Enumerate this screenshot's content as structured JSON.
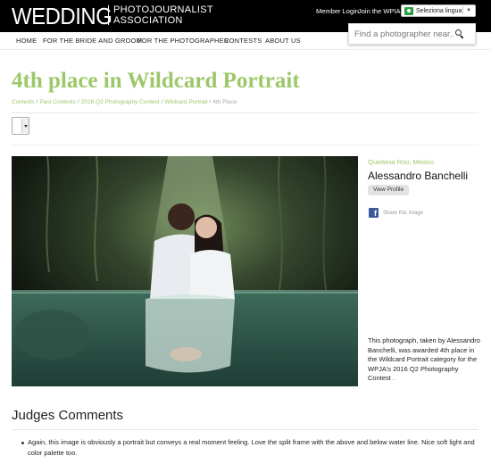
{
  "header": {
    "logo_main": "WEDDING",
    "logo_line1": "PHOTOJOURNALIST",
    "logo_line2": "ASSOCIATION",
    "member_login": "Member Login",
    "join": "Join the WPIA",
    "language_label": "Seleziona lingua",
    "search_placeholder": "Find a photographer near..."
  },
  "nav": {
    "items": [
      "HOME",
      "FOR THE BRIDE AND GROOM",
      "FOR THE PHOTOGRAPHER",
      "CONTESTS",
      "ABOUT US"
    ]
  },
  "page": {
    "title": "4th place in Wildcard Portrait",
    "breadcrumb": [
      "Contests",
      "Past Contests",
      "2016 Q2 Photography Contest",
      "Wildcard Portrait",
      "4th Place"
    ]
  },
  "photo_info": {
    "location": "Quintana Roo, Mexico",
    "photographer": "Alessandro Banchelli",
    "view_profile": "View Profile",
    "share": "Share this image",
    "caption": "This photograph, taken by Alessandro Banchelli, was awarded 4th place in the Wildcard Portrait category for the WPJA's 2016 Q2 Photography Contest ."
  },
  "judges": {
    "title": "Judges Comments",
    "comments": [
      "Again, this image is obviously a portrait but conveys a real moment feeling. Love the split frame with the above and below water line. Nice soft light and color palette too."
    ]
  },
  "colors": {
    "accent_green": "#9cc86a",
    "facebook_blue": "#3b5998",
    "topbar": "#000000"
  }
}
